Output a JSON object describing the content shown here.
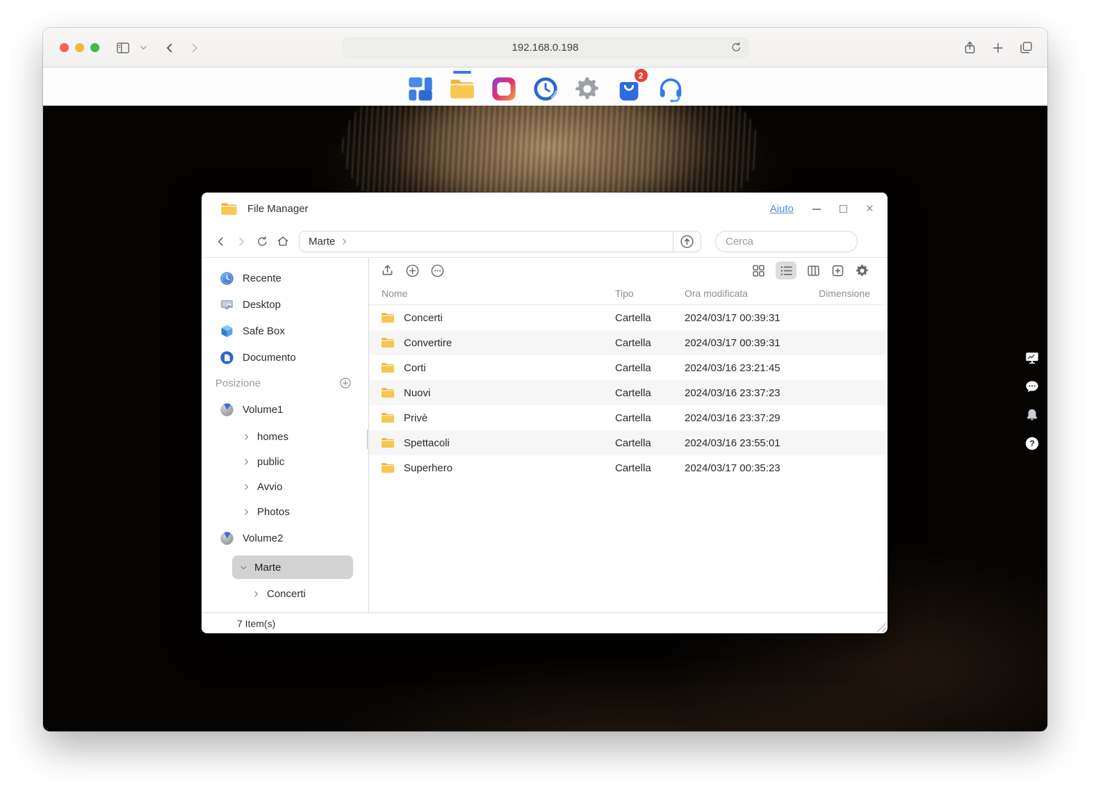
{
  "browser": {
    "url": "192.168.0.198"
  },
  "dock": {
    "apps": [
      {
        "name": "app-overview"
      },
      {
        "name": "file-manager",
        "active": true
      },
      {
        "name": "photo-gallery"
      },
      {
        "name": "backup"
      },
      {
        "name": "settings"
      },
      {
        "name": "app-central",
        "badge": "2"
      },
      {
        "name": "online-support"
      }
    ]
  },
  "fm": {
    "title": "File Manager",
    "help_link": "Aiuto",
    "breadcrumb": {
      "current": "Marte"
    },
    "search": {
      "placeholder": "Cerca"
    },
    "status": "7 Item(s)",
    "sidebar": {
      "quick": [
        {
          "label": "Recente"
        },
        {
          "label": "Desktop"
        },
        {
          "label": "Safe Box"
        },
        {
          "label": "Documento"
        }
      ],
      "section_header": "Posizione",
      "volumes": [
        {
          "label": "Volume1",
          "children": [
            {
              "label": "homes"
            },
            {
              "label": "public"
            },
            {
              "label": "Avvio"
            },
            {
              "label": "Photos"
            }
          ]
        },
        {
          "label": "Volume2",
          "children": [
            {
              "label": "Marte",
              "selected": true,
              "expanded": true,
              "children": [
                {
                  "label": "Concerti"
                }
              ]
            }
          ]
        }
      ]
    },
    "table": {
      "columns": [
        "Nome",
        "Tipo",
        "Ora modificata",
        "Dimensione"
      ],
      "rows": [
        {
          "name": "Concerti",
          "type": "Cartella",
          "modified": "2024/03/17 00:39:31",
          "size": ""
        },
        {
          "name": "Convertire",
          "type": "Cartella",
          "modified": "2024/03/17 00:39:31",
          "size": ""
        },
        {
          "name": "Corti",
          "type": "Cartella",
          "modified": "2024/03/16 23:21:45",
          "size": ""
        },
        {
          "name": "Nuovi",
          "type": "Cartella",
          "modified": "2024/03/16 23:37:23",
          "size": ""
        },
        {
          "name": "Privè",
          "type": "Cartella",
          "modified": "2024/03/16 23:37:29",
          "size": ""
        },
        {
          "name": "Spettacoli",
          "type": "Cartella",
          "modified": "2024/03/16 23:55:01",
          "size": ""
        },
        {
          "name": "Superhero",
          "type": "Cartella",
          "modified": "2024/03/17 00:35:23",
          "size": ""
        }
      ]
    }
  },
  "colors": {
    "accent_blue": "#3478f6",
    "folder_gold": "#f6c64f",
    "badge_red": "#e0443a",
    "link_blue": "#4a90d9"
  }
}
